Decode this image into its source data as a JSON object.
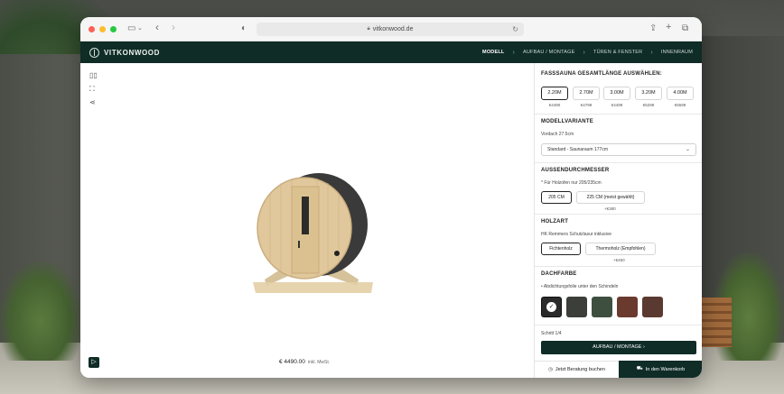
{
  "browser": {
    "url": "vitkonwood.de"
  },
  "site": {
    "logo_text": "VITKONWOOD",
    "steps": [
      {
        "label": "MODELL"
      },
      {
        "label": "AUFBAU / MONTAGE"
      },
      {
        "label": "TÜREN & FENSTER"
      },
      {
        "label": "INNENRAUM"
      }
    ]
  },
  "viewer": {
    "price": "€ 4490.00",
    "price_note": "inkl. MwSt."
  },
  "config": {
    "length": {
      "title": "FASSSAUNA GESAMTLÄNGE AUSWÄHLEN:",
      "options": [
        {
          "label": "2.20M",
          "price": "€4490",
          "selected": true
        },
        {
          "label": "2.70M",
          "price": "€4799",
          "selected": false
        },
        {
          "label": "3.00M",
          "price": "€4499",
          "selected": false
        },
        {
          "label": "3.20M",
          "price": "€5299",
          "selected": false
        },
        {
          "label": "4.00M",
          "price": "€5599",
          "selected": false
        }
      ]
    },
    "variant": {
      "title": "MODELLVARIANTE",
      "subtitle": "Vordach 27.5cm",
      "selected": "Standard - Saunaraum 177cm"
    },
    "diameter": {
      "title": "AUSSENDURCHMESSER",
      "subtitle": "* Für Holzofen nur 205/235cm",
      "options": [
        {
          "label": "205 CM",
          "selected": true
        },
        {
          "label": "225 CM (meist gewählt)",
          "price": "+€380",
          "selected": false
        }
      ]
    },
    "wood": {
      "title": "HOLZART",
      "subtitle": "HK Remmers Schutzlasur inklusive",
      "options": [
        {
          "label": "Fichtenholz",
          "selected": true
        },
        {
          "label": "Thermoholz (Empfohlen)",
          "price": "+€450",
          "selected": false
        }
      ]
    },
    "roof": {
      "title": "DACHFARBE",
      "subtitle": "• Abdichtungsfolie unter den Schindeln",
      "swatches": [
        {
          "color": "#2a2a2a",
          "selected": true
        },
        {
          "color": "#3b3e39",
          "selected": false
        },
        {
          "color": "#3e4f3f",
          "selected": false
        },
        {
          "color": "#6a3a2e",
          "selected": false
        },
        {
          "color": "#5a3a30",
          "selected": false
        }
      ]
    },
    "step_counter": "Schritt 1/4",
    "next_label": "AUFBAU / MONTAGE",
    "consult_label": "Jetzt Beratung buchen",
    "cart_label": "In den Warenkorb"
  }
}
